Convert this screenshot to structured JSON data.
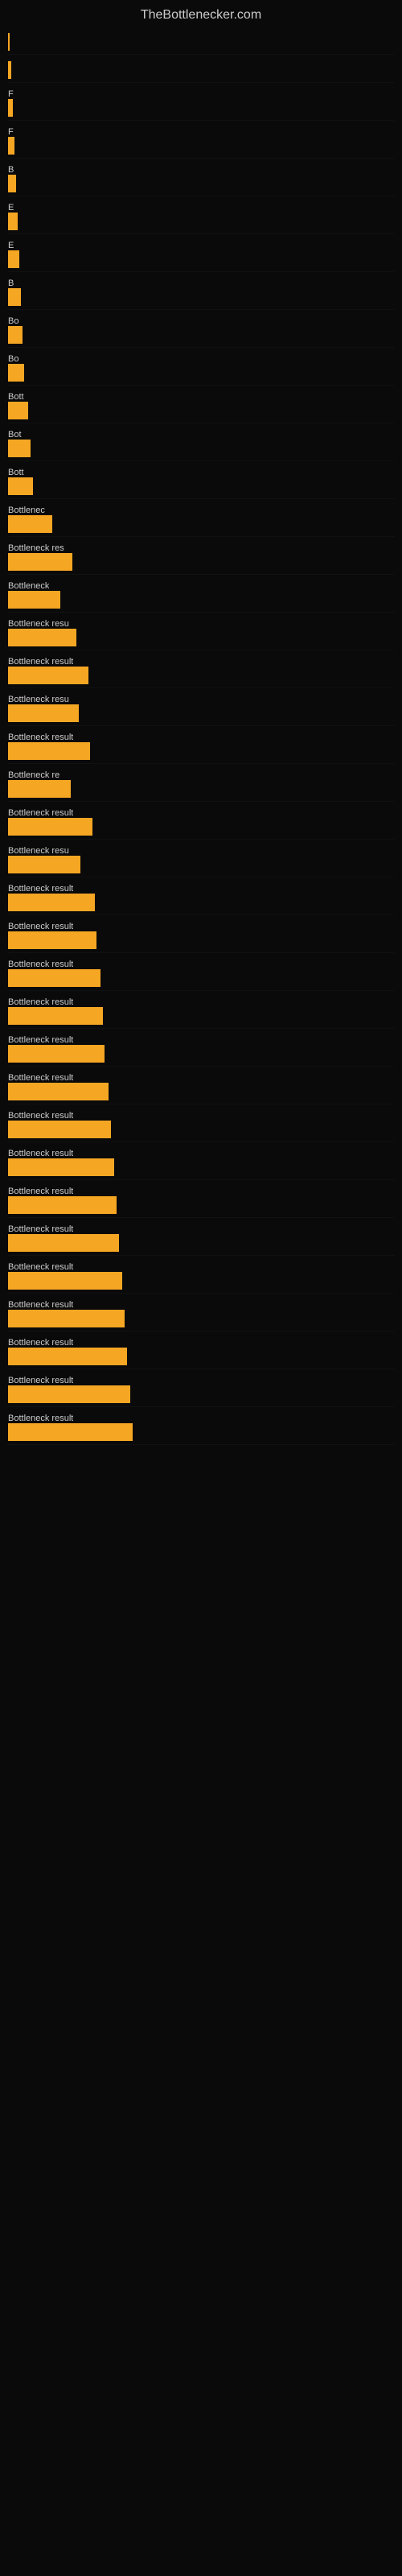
{
  "site": {
    "title": "TheBottlenecker.com"
  },
  "bars": [
    {
      "label": "",
      "width": 2
    },
    {
      "label": "",
      "width": 4
    },
    {
      "label": "F",
      "width": 6
    },
    {
      "label": "F",
      "width": 8
    },
    {
      "label": "B",
      "width": 10
    },
    {
      "label": "E",
      "width": 12
    },
    {
      "label": "E",
      "width": 14
    },
    {
      "label": "B",
      "width": 16
    },
    {
      "label": "Bo",
      "width": 18
    },
    {
      "label": "Bo",
      "width": 20
    },
    {
      "label": "Bott",
      "width": 25
    },
    {
      "label": "Bot",
      "width": 28
    },
    {
      "label": "Bott",
      "width": 31
    },
    {
      "label": "Bottlenec",
      "width": 55
    },
    {
      "label": "Bottleneck res",
      "width": 80
    },
    {
      "label": "Bottleneck",
      "width": 65
    },
    {
      "label": "Bottleneck resu",
      "width": 85
    },
    {
      "label": "Bottleneck result",
      "width": 100
    },
    {
      "label": "Bottleneck resu",
      "width": 88
    },
    {
      "label": "Bottleneck result",
      "width": 102
    },
    {
      "label": "Bottleneck re",
      "width": 78
    },
    {
      "label": "Bottleneck result",
      "width": 105
    },
    {
      "label": "Bottleneck resu",
      "width": 90
    },
    {
      "label": "Bottleneck result",
      "width": 108
    },
    {
      "label": "Bottleneck result",
      "width": 110
    },
    {
      "label": "Bottleneck result",
      "width": 115
    },
    {
      "label": "Bottleneck result",
      "width": 118
    },
    {
      "label": "Bottleneck result",
      "width": 120
    },
    {
      "label": "Bottleneck result",
      "width": 125
    },
    {
      "label": "Bottleneck result",
      "width": 128
    },
    {
      "label": "Bottleneck result",
      "width": 132
    },
    {
      "label": "Bottleneck result",
      "width": 135
    },
    {
      "label": "Bottleneck result",
      "width": 138
    },
    {
      "label": "Bottleneck result",
      "width": 142
    },
    {
      "label": "Bottleneck result",
      "width": 145
    },
    {
      "label": "Bottleneck result",
      "width": 148
    },
    {
      "label": "Bottleneck result",
      "width": 152
    },
    {
      "label": "Bottleneck result",
      "width": 155
    }
  ]
}
